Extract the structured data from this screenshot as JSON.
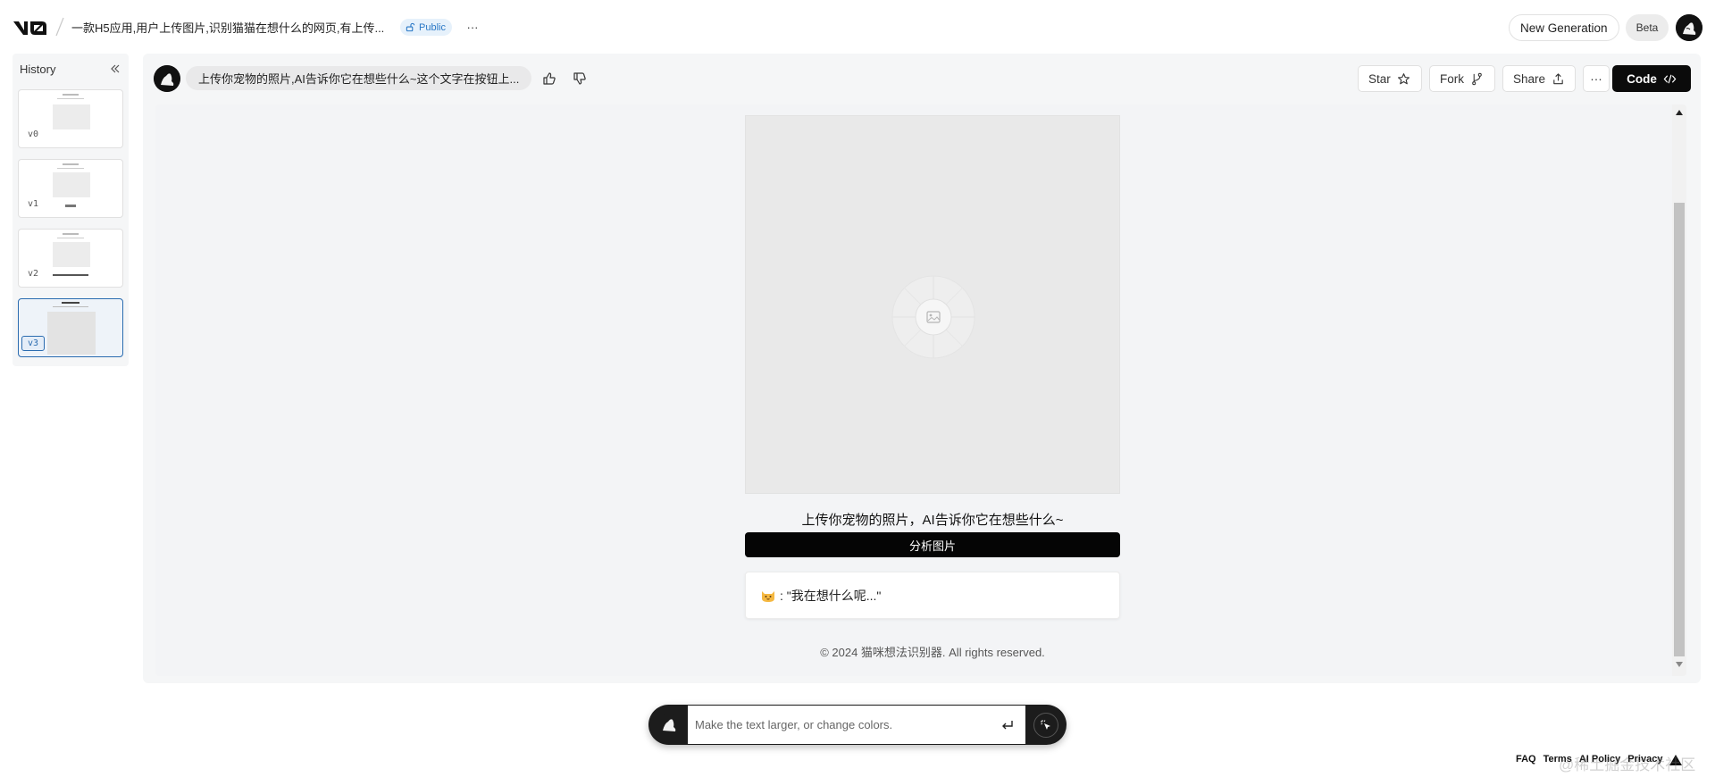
{
  "header": {
    "project_title": "一款H5应用,用户上传图片,识别猫猫在想什么的网页,有上传...",
    "visibility_badge": "Public",
    "more_label": "···",
    "new_generation_label": "New Generation",
    "beta_label": "Beta"
  },
  "sidebar": {
    "title": "History",
    "versions": [
      {
        "label": "v0"
      },
      {
        "label": "v1"
      },
      {
        "label": "v2"
      },
      {
        "label": "v3",
        "active": true
      }
    ]
  },
  "conversation": {
    "prompt_text": "上传你宠物的照片,AI告诉你它在想些什么~这个文字在按钮上..."
  },
  "toolbar": {
    "star_label": "Star",
    "fork_label": "Fork",
    "share_label": "Share",
    "more_label": "···",
    "code_label": "Code"
  },
  "preview": {
    "upload_text": "上传你宠物的照片，AI告诉你它在想些什么~",
    "analyze_button": "分析图片",
    "result_text": ": \"我在想什么呢...\"",
    "footer_text": "© 2024 猫咪想法识别器. All rights reserved."
  },
  "chat": {
    "placeholder": "Make the text larger, or change colors."
  },
  "footer": {
    "links": [
      "FAQ",
      "Terms",
      "AI Policy",
      "Privacy"
    ]
  },
  "watermark": "@稀土掘金技术社区",
  "colors": {
    "accent_badge_bg": "#e6f1fb",
    "accent_badge_text": "#2a78c6",
    "active_version": "#2b6cb0",
    "primary_button": "#050505"
  }
}
